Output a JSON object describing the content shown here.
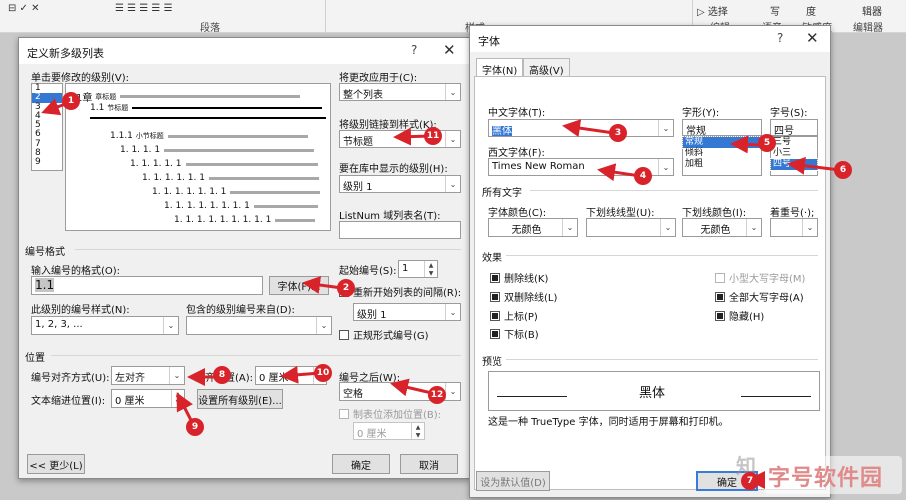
{
  "ribbon": {
    "paragraph_group": "段落",
    "style_group": "样式",
    "select_label": "选择",
    "edit_group": "编辑",
    "voice_group": "语音",
    "sensitivity_group": "敏感度",
    "editor_top": "辑器",
    "editor_group": "编辑器",
    "write_label": "写",
    "voice_top": "语",
    "sensitivity_top": "度"
  },
  "multilevel": {
    "title": "定义新多级列表",
    "help": "?",
    "close": "✕",
    "level_label": "单击要修改的级别(V):",
    "levels": [
      "1",
      "2",
      "3",
      "4",
      "5",
      "6",
      "7",
      "8",
      "9"
    ],
    "selected_level_index": 1,
    "preview": {
      "l1_text": "1章",
      "l1_small": "章标题",
      "l2_text": "1.1",
      "l2_small": "节标题",
      "l3_text": "1.1.1",
      "l3_small": "小节标题",
      "l4_text": "1. 1. 1. 1",
      "l5_text": "1. 1. 1. 1. 1",
      "l6_text": "1. 1. 1. 1. 1. 1",
      "l7_text": "1. 1. 1. 1. 1. 1. 1",
      "l8_text": "1. 1. 1. 1. 1. 1. 1. 1",
      "l9_text": "1. 1. 1. 1. 1. 1. 1. 1. 1"
    },
    "apply_to_label": "将更改应用于(C):",
    "apply_to_value": "整个列表",
    "link_style_label": "将级别链接到样式(K):",
    "link_style_value": "节标题",
    "gallery_level_label": "要在库中显示的级别(H):",
    "gallery_level_value": "级别 1",
    "listnum_label": "ListNum 域列表名(T):",
    "listnum_value": "",
    "number_format_section": "编号格式",
    "enter_format_label": "输入编号的格式(O):",
    "format_value": "1.1",
    "font_button": "字体(F)...",
    "start_at_label": "起始编号(S):",
    "start_at_value": "1",
    "restart_label": "重新开始列表的间隔(R):",
    "restart_value": "级别 1",
    "style_label": "此级别的编号样式(N):",
    "style_value": "1, 2, 3, ...",
    "include_from_label": "包含的级别编号来自(D):",
    "include_from_value": "",
    "legal_label": "正规形式编号(G)",
    "position_section": "位置",
    "alignment_label": "编号对齐方式(U):",
    "alignment_value": "左对齐",
    "aligned_at_label": "对齐位置(A):",
    "aligned_at_value": "0 厘米",
    "follow_label": "编号之后(W):",
    "follow_value": "空格",
    "indent_label": "文本缩进位置(I):",
    "indent_value": "0 厘米",
    "set_all_button": "设置所有级别(E)...",
    "tab_stop_label": "制表位添加位置(B):",
    "tab_stop_value": "0 厘米",
    "less_button": "<< 更少(L)",
    "ok_button": "确定",
    "cancel_button": "取消"
  },
  "font": {
    "title": "字体",
    "help": "?",
    "close": "✕",
    "tab_font": "字体(N)",
    "tab_advanced": "高级(V)",
    "cjk_font_label": "中文字体(T):",
    "cjk_font_value": "黑体",
    "style_label": "字形(Y):",
    "style_value": "常规",
    "style_options": [
      "常规",
      "倾斜",
      "加粗"
    ],
    "style_selected_index": 0,
    "size_label": "字号(S):",
    "size_value": "四号",
    "size_options": [
      "三号",
      "小三",
      "四号"
    ],
    "size_selected_index": 2,
    "latin_font_label": "西文字体(F):",
    "latin_font_value": "Times New Roman",
    "all_text_section": "所有文字",
    "font_color_label": "字体颜色(C):",
    "font_color_value": "无颜色",
    "underline_label": "下划线线型(U):",
    "underline_value": "",
    "underline_color_label": "下划线颜色(I):",
    "underline_color_value": "无颜色",
    "emphasis_label": "着重号(·);",
    "emphasis_value": "",
    "effects_section": "效果",
    "effects": {
      "strike": "删除线(K)",
      "double_strike": "双删除线(L)",
      "superscript": "上标(P)",
      "subscript": "下标(B)",
      "small_caps": "小型大写字母(M)",
      "all_caps": "全部大写字母(A)",
      "hidden": "隐藏(H)"
    },
    "preview_section": "预览",
    "preview_text": "黑体",
    "preview_note": "这是一种 TrueType 字体，同时适用于屏幕和打印机。",
    "set_default_button": "设为默认值(D)",
    "ok_button": "确定"
  },
  "markers": [
    "1",
    "2",
    "3",
    "4",
    "5",
    "6",
    "7",
    "8",
    "9",
    "10",
    "11",
    "12"
  ],
  "watermark": {
    "left_text": "知",
    "right_text": "字号软件园"
  },
  "colors": {
    "marker": "#d9232a",
    "selection": "#3478d4"
  }
}
